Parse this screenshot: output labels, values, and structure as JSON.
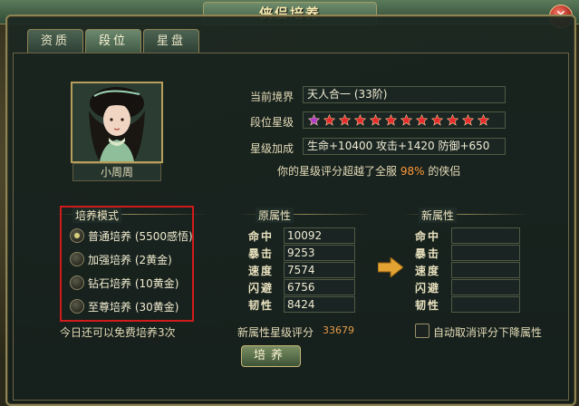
{
  "window": {
    "title": "侠侣培养"
  },
  "tabs": [
    {
      "label": "资质"
    },
    {
      "label": "段位"
    },
    {
      "label": "星盘"
    }
  ],
  "character": {
    "name": "小周周"
  },
  "info": {
    "realm_label": "当前境界",
    "realm_value": "天人合一 (33阶)",
    "stars_label": "段位星级",
    "stars_total": 12,
    "stars_special": 1,
    "bonus_label": "星级加成",
    "bonus_value": "生命+10400  攻击+1420  防御+650",
    "rank_note_prefix": "你的星级评分超越了全服",
    "rank_percent": "98%",
    "rank_note_suffix": "的侠侣"
  },
  "modes": {
    "header": "培养模式",
    "selected_index": 0,
    "items": [
      {
        "label": "普通培养 (5500感悟)"
      },
      {
        "label": "加强培养 (2黄金)"
      },
      {
        "label": "钻石培养 (10黄金)"
      },
      {
        "label": "至尊培养 (30黄金)"
      }
    ]
  },
  "original_attrs": {
    "header": "原属性",
    "rows": [
      {
        "name": "命中",
        "value": "10092"
      },
      {
        "name": "暴击",
        "value": "9253"
      },
      {
        "name": "速度",
        "value": "7574"
      },
      {
        "name": "闪避",
        "value": "6756"
      },
      {
        "name": "韧性",
        "value": "8424"
      }
    ]
  },
  "new_attrs": {
    "header": "新属性",
    "rows": [
      {
        "name": "命中"
      },
      {
        "name": "暴击"
      },
      {
        "name": "速度"
      },
      {
        "name": "闪避"
      },
      {
        "name": "韧性"
      }
    ]
  },
  "footer": {
    "free_times": "今日还可以免费培养3次",
    "new_score_label": "新属性星级评分",
    "new_score_value": "33679",
    "auto_cancel_label": "自动取消评分下降属性",
    "train_button": "培养"
  },
  "colors": {
    "highlight_box": "#d01b1b",
    "star": "#e8292a",
    "star_special": "#b23bc9",
    "rank_percent": "#ff9a3a"
  }
}
